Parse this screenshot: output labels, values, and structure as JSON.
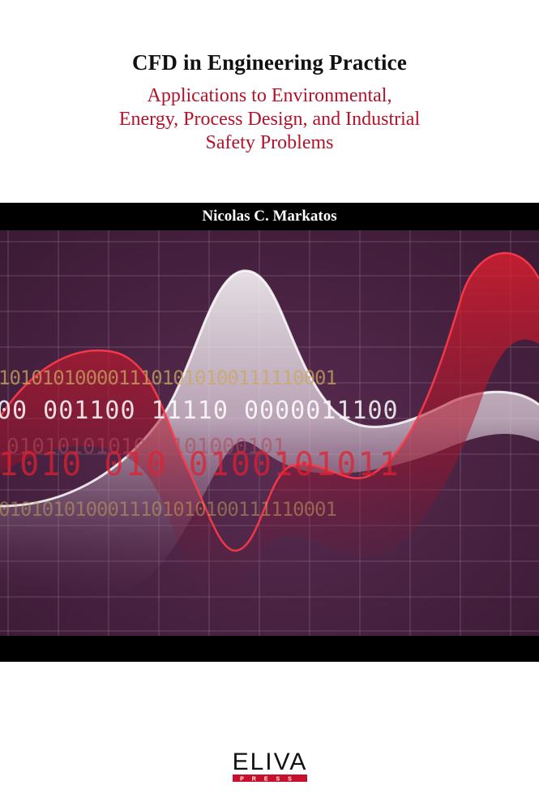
{
  "book": {
    "title": "CFD in Engineering Practice",
    "subtitle_lines": [
      "Applications to Environmental,",
      "Energy, Process Design, and Industrial",
      "Safety Problems"
    ],
    "author": "Nicolas C. Markatos"
  },
  "artwork": {
    "binary_rows": [
      "1010101000011101010100111110001",
      "00 001100 11110 0000011100",
      "0101010101001101000101",
      "1010 010 0100101011",
      "0101010100011101010100111110001"
    ]
  },
  "publisher": {
    "logo_text": "ELIVA",
    "tagline": "PRESS"
  },
  "colors": {
    "title": "#111111",
    "subtitle": "#b3122a",
    "band": "#000000",
    "art_background": "#45213f",
    "accent_red": "#d11a2a"
  }
}
